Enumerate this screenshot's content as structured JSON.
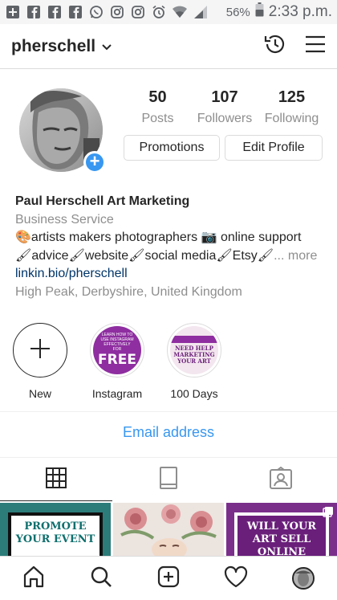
{
  "status_bar": {
    "left_icons": [
      "add-box-icon",
      "facebook-icon",
      "facebook-icon",
      "facebook-icon",
      "whatsapp-icon",
      "instagram-icon",
      "instagram-icon",
      "alarm-icon",
      "wifi-icon",
      "signal-icon"
    ],
    "battery": "56%",
    "time": "2:33 p.m."
  },
  "header": {
    "username": "pherschell",
    "caret": "⌄"
  },
  "profile": {
    "stats": [
      {
        "value": "50",
        "label": "Posts"
      },
      {
        "value": "107",
        "label": "Followers"
      },
      {
        "value": "125",
        "label": "Following"
      }
    ],
    "promotions_label": "Promotions",
    "edit_profile_label": "Edit Profile",
    "add_badge": "+"
  },
  "bio": {
    "name": "Paul Herschell Art Marketing",
    "category": "Business Service",
    "line1": "🎨artists makers photographers 📷 online support",
    "line2": "🖌advice🖌website🖌social media🖌Etsy🖌",
    "more": "... more",
    "link": "linkin.bio/pherschell",
    "location": "High Peak, Derbyshire, United Kingdom"
  },
  "highlights": [
    {
      "label": "New",
      "icon": "plus-icon"
    },
    {
      "label": "Instagram",
      "inner_top": "LEARN HOW TO USE INSTAGRAM EFFECTIVELY FOR",
      "inner_big": "FREE"
    },
    {
      "label": "100 Days",
      "inner_text": "NEED HELP MARKETING YOUR ART"
    }
  ],
  "email_label": "Email address",
  "tabs": [
    "grid-icon",
    "tagged-feed-icon",
    "tagged-person-icon"
  ],
  "grid": [
    {
      "text": "PROMOTE YOUR EVENT"
    },
    {
      "text": ""
    },
    {
      "text": "WILL YOUR ART SELL ONLINE"
    }
  ],
  "colors": {
    "accent": "#3897f0",
    "link": "#003569",
    "muted": "#8e8e8e",
    "text": "#262626"
  },
  "bottom_nav": [
    "home-icon",
    "search-icon",
    "new-post-icon",
    "activity-heart-icon",
    "profile-avatar"
  ]
}
